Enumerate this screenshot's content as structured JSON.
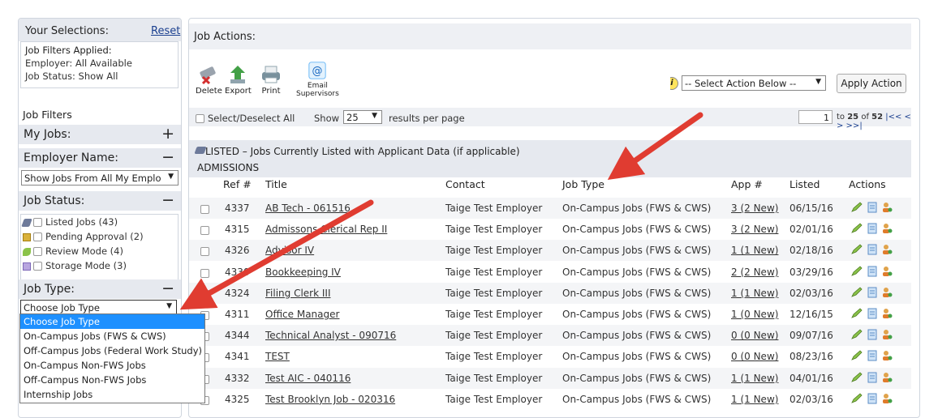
{
  "selections": {
    "title": "Your Selections:",
    "reset_label": "Reset",
    "filters_applied_label": "Job Filters Applied:",
    "employer_line": "Employer: All Available",
    "status_line": "Job Status: Show All"
  },
  "filters": {
    "title": "Job Filters",
    "my_jobs": {
      "label": "My Jobs:",
      "toggle": "+"
    },
    "employer": {
      "label": "Employer Name:",
      "toggle": "−",
      "select_value": "Show Jobs From All My Emplo"
    },
    "status": {
      "label": "Job Status:",
      "toggle": "−",
      "options": [
        {
          "label": "Listed Jobs (43)",
          "icon": "listed-icon"
        },
        {
          "label": "Pending Approval (2)",
          "icon": "pending-icon"
        },
        {
          "label": "Review Mode (4)",
          "icon": "review-icon"
        },
        {
          "label": "Storage Mode (3)",
          "icon": "storage-icon"
        }
      ]
    },
    "job_type": {
      "label": "Job Type:",
      "toggle": "−",
      "select_value": "Choose Job Type",
      "options": [
        "Choose Job Type",
        "On-Campus Jobs (FWS & CWS)",
        "Off-Campus Jobs (Federal Work Study)",
        "On-Campus Non-FWS Jobs",
        "Off-Campus Non-FWS Jobs",
        "Internship Jobs"
      ]
    }
  },
  "job_actions": {
    "title": "Job Actions:",
    "toolbar": {
      "delete": "Delete",
      "export": "Export",
      "print": "Print",
      "email_line1": "Email",
      "email_line2": "Supervisors"
    },
    "action_select": "-- Select Action Below --",
    "apply_label": "Apply Action"
  },
  "list_bar": {
    "select_all": "Select/Deselect All",
    "show_label": "Show",
    "per_page_value": "25",
    "per_page_suffix": "results per page",
    "page_input": "1",
    "page_info_prefix": "to ",
    "page_info_bold": "25",
    "page_info_mid": " of ",
    "page_info_total": "52",
    "page_nav": " |<<  <  >  >>|"
  },
  "listing": {
    "section_title": "LISTED – Jobs Currently Listed with Applicant Data (if applicable)",
    "group": "ADMISSIONS",
    "columns": [
      "Ref #",
      "Title",
      "Contact",
      "Job Type",
      "App #",
      "Listed",
      "Actions"
    ],
    "rows": [
      {
        "ref": "4337",
        "title": "AB Tech - 061516",
        "contact": "Taige Test Employer",
        "type": "On-Campus Jobs (FWS & CWS)",
        "app": "3 (2 New)",
        "listed": "06/15/16"
      },
      {
        "ref": "4315",
        "title": "Admissons Clerical Rep II",
        "contact": "Taige Test Employer",
        "type": "On-Campus Jobs (FWS & CWS)",
        "app": "3 (2 New)",
        "listed": "02/01/16"
      },
      {
        "ref": "4326",
        "title": "Advisor IV",
        "contact": "Taige Test Employer",
        "type": "On-Campus Jobs (FWS & CWS)",
        "app": "1 (1 New)",
        "listed": "02/18/16"
      },
      {
        "ref": "4330",
        "title": "Bookkeeping IV",
        "contact": "Taige Test Employer",
        "type": "On-Campus Jobs (FWS & CWS)",
        "app": "2 (2 New)",
        "listed": "03/29/16"
      },
      {
        "ref": "4324",
        "title": "Filing Clerk III",
        "contact": "Taige Test Employer",
        "type": "On-Campus Jobs (FWS & CWS)",
        "app": "1 (1 New)",
        "listed": "02/03/16"
      },
      {
        "ref": "4311",
        "title": "Office Manager",
        "contact": "Taige Test Employer",
        "type": "On-Campus Jobs (FWS & CWS)",
        "app": "1 (0 New)",
        "listed": "12/16/15"
      },
      {
        "ref": "4344",
        "title": "Technical Analyst - 090716",
        "contact": "Taige Test Employer",
        "type": "On-Campus Jobs (FWS & CWS)",
        "app": "0 (0 New)",
        "listed": "09/07/16"
      },
      {
        "ref": "4341",
        "title": "TEST",
        "contact": "Taige Test Employer",
        "type": "On-Campus Jobs (FWS & CWS)",
        "app": "0 (0 New)",
        "listed": "08/23/16"
      },
      {
        "ref": "4332",
        "title": "Test AIC - 040116",
        "contact": "Taige Test Employer",
        "type": "On-Campus Jobs (FWS & CWS)",
        "app": "1 (1 New)",
        "listed": "04/01/16"
      },
      {
        "ref": "4325",
        "title": "Test Brooklyn Job - 020316",
        "contact": "Taige Test Employer",
        "type": "On-Campus Jobs (FWS & CWS)",
        "app": "1 (1 New)",
        "listed": "02/03/16"
      }
    ]
  },
  "colors": {
    "header_bg": "#e6e9ef",
    "link": "#1a3f8f",
    "selected_option": "#1e90ff",
    "arrow": "#e03c31"
  }
}
